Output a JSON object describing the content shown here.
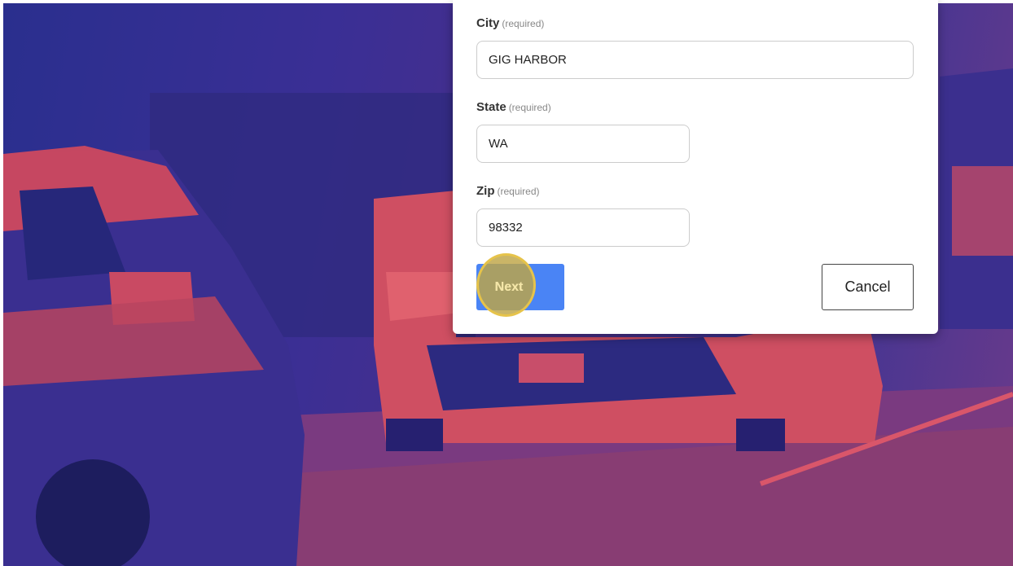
{
  "form": {
    "city": {
      "label": "City",
      "required": "(required)",
      "value": "GIG HARBOR"
    },
    "state": {
      "label": "State",
      "required": "(required)",
      "value": "WA"
    },
    "zip": {
      "label": "Zip",
      "required": "(required)",
      "value": "98332"
    },
    "next_label": "Next",
    "cancel_label": "Cancel"
  },
  "colors": {
    "primary_button": "#4a84f5",
    "click_highlight": "#e6c34a",
    "background_tint_red": "#e0455a",
    "background_tint_blue": "#2a2f8e"
  }
}
